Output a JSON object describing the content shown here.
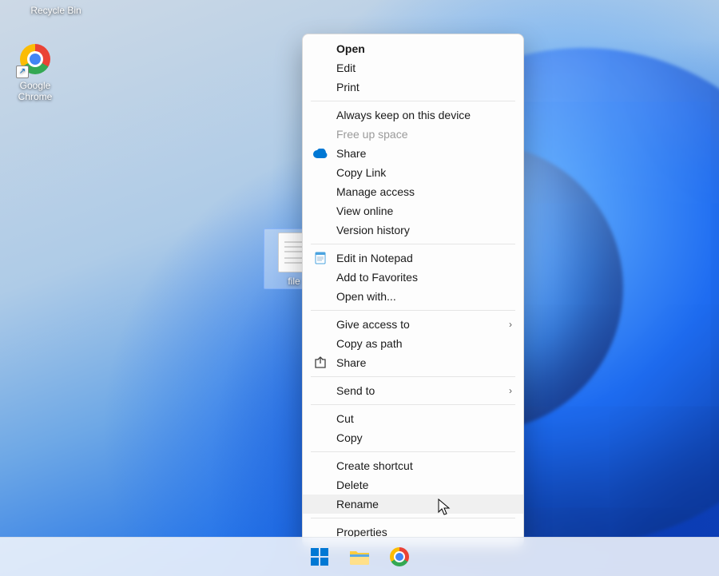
{
  "desktop": {
    "recycle_bin_label": "Recycle Bin",
    "chrome_label": "Google\nChrome",
    "file_label": "file"
  },
  "context_menu": {
    "open": "Open",
    "edit": "Edit",
    "print": "Print",
    "always_keep": "Always keep on this device",
    "free_up": "Free up space",
    "share_onedrive": "Share",
    "copy_link": "Copy Link",
    "manage_access": "Manage access",
    "view_online": "View online",
    "version_history": "Version history",
    "edit_notepad": "Edit in Notepad",
    "add_favorites": "Add to Favorites",
    "open_with": "Open with...",
    "give_access": "Give access to",
    "copy_as_path": "Copy as path",
    "share_system": "Share",
    "send_to": "Send to",
    "cut": "Cut",
    "copy": "Copy",
    "create_shortcut": "Create shortcut",
    "delete": "Delete",
    "rename": "Rename",
    "properties": "Properties"
  }
}
